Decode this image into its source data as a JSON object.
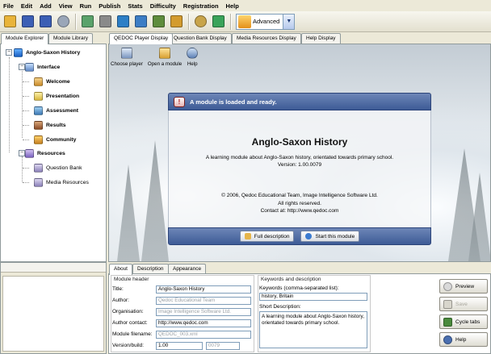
{
  "menu": [
    "File",
    "Edit",
    "Add",
    "View",
    "Run",
    "Publish",
    "Stats",
    "Difficulty",
    "Registration",
    "Help"
  ],
  "toolbar": {
    "icons": [
      {
        "name": "open-folder-icon",
        "color": "#e9b43a"
      },
      {
        "name": "save-icon",
        "color": "#3c5fb5"
      },
      {
        "name": "save-all-icon",
        "color": "#3c5fb5"
      },
      {
        "name": "properties-icon",
        "color": "#9aa6b8"
      },
      {
        "name": "image-icon",
        "color": "#5aa26a"
      },
      {
        "name": "export-icon",
        "color": "#8a8a8a"
      },
      {
        "name": "arrow-right-icon",
        "color": "#2d7fc6"
      },
      {
        "name": "network-icon",
        "color": "#3c7dc5"
      },
      {
        "name": "gallery-icon",
        "color": "#5e8c3c"
      },
      {
        "name": "media-icon",
        "color": "#d39b2e"
      },
      {
        "name": "stopwatch-icon",
        "color": "#c8a44a"
      },
      {
        "name": "stats-chart-icon",
        "color": "#3aa35a"
      }
    ],
    "mode": "Advanced"
  },
  "left_tabs": [
    "Module Explorer",
    "Module Library"
  ],
  "tree": {
    "root": "Anglo-Saxon History",
    "interface": "Interface",
    "interface_children": [
      "Welcome",
      "Presentation",
      "Assessment",
      "Results",
      "Community"
    ],
    "resources": "Resources",
    "resources_children": [
      "Question Bank",
      "Media Resources"
    ]
  },
  "right_tabs": [
    "QEDOC Player Display",
    "Question Bank Display",
    "Media Resources Display",
    "Help Display"
  ],
  "player": {
    "toolbar": [
      "Choose player",
      "Open a module",
      "Help"
    ],
    "banner": "A module is loaded and ready.",
    "title": "Anglo-Saxon History",
    "desc1": "A learning module about Anglo-Saxon history, orientated towards primary school.",
    "desc2": "Version: 1.00.0079",
    "copy1": "© 2006, Qedoc Educational Team, Image Intelligence Software Ltd.",
    "copy2": "All rights reserved.",
    "copy3": "Contact at: http://www.qedoc.com",
    "btn_full": "Full description",
    "btn_start": "Start this module"
  },
  "bottom_tabs": [
    "About",
    "Description",
    "Appearance"
  ],
  "module_header": {
    "group": "Module header",
    "title_label": "Title:",
    "title": "Anglo-Saxon History",
    "author_label": "Author:",
    "author": "Qedoc Educational Team",
    "org_label": "Organisation:",
    "org": "Image Intelligence Software Ltd.",
    "contact_label": "Author contact:",
    "contact": "http://www.qedoc.com",
    "filename_label": "Module filename:",
    "filename": "QEDOC_003.xml",
    "version_label": "Version/build:",
    "version": "1.00",
    "build": "0079"
  },
  "keywords": {
    "group": "Keywords and description",
    "kw_label": "Keywords (comma-separated list):",
    "kw": "history, Britain",
    "short_label": "Short Description:",
    "short1": "A learning module about Anglo-Saxon history,",
    "short2": "orientated towards primary school."
  },
  "side_buttons": [
    "Preview",
    "Save",
    "Cycle tabs",
    "Help"
  ]
}
